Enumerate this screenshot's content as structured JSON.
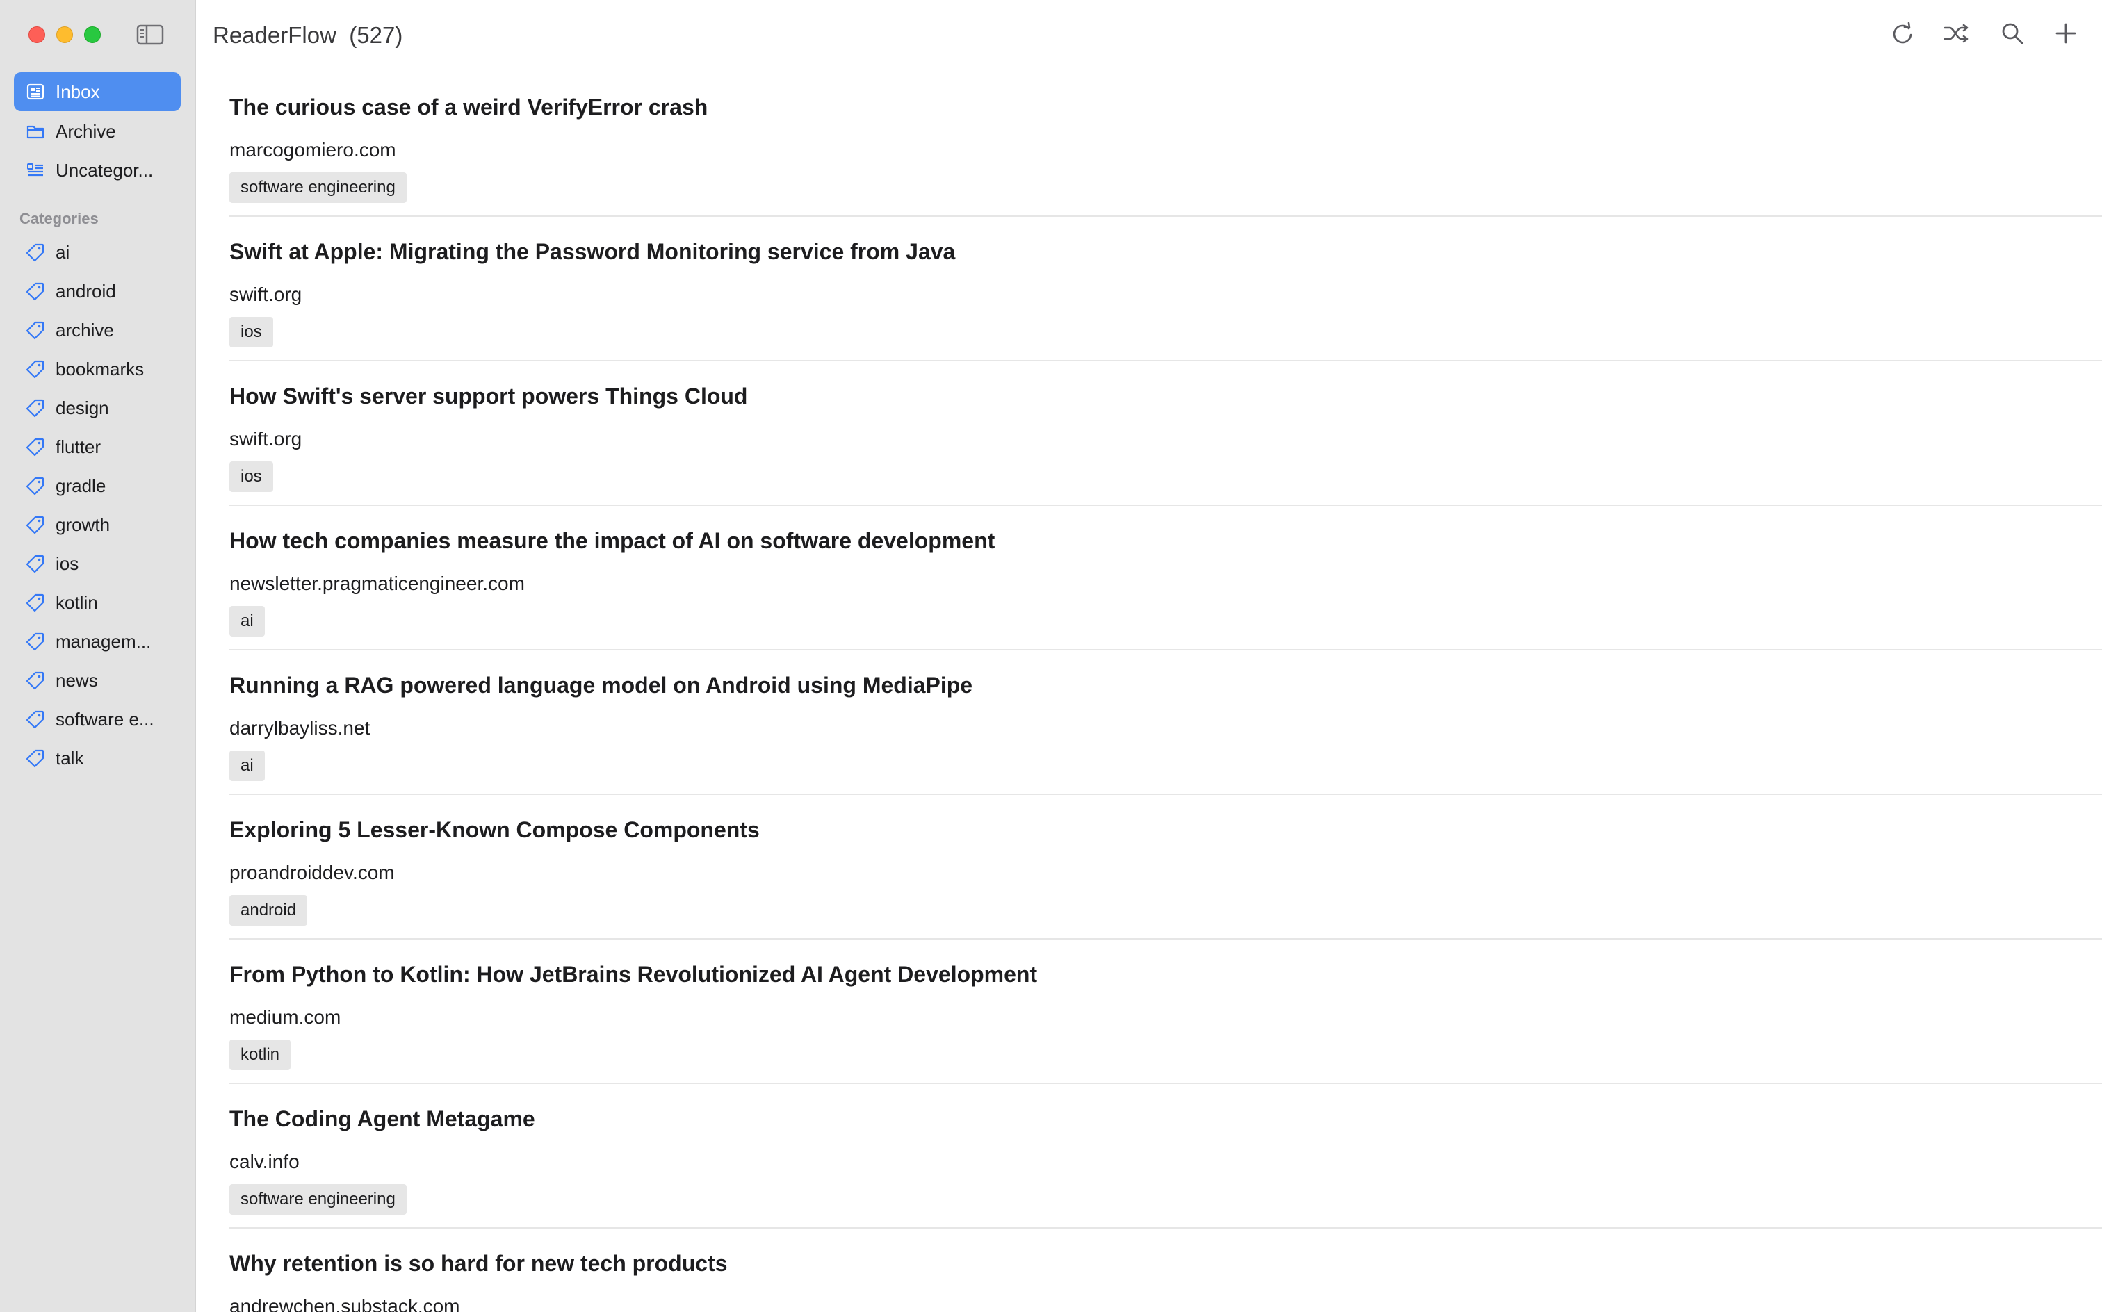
{
  "app": {
    "title": "ReaderFlow",
    "count": "(527)"
  },
  "sidebar": {
    "nav": [
      {
        "label": "Inbox",
        "icon": "inbox-icon",
        "active": true
      },
      {
        "label": "Archive",
        "icon": "folder-icon",
        "active": false
      },
      {
        "label": "Uncategor...",
        "icon": "list-icon",
        "active": false
      }
    ],
    "categories_heading": "Categories",
    "categories": [
      {
        "label": "ai"
      },
      {
        "label": "android"
      },
      {
        "label": "archive"
      },
      {
        "label": "bookmarks"
      },
      {
        "label": "design"
      },
      {
        "label": "flutter"
      },
      {
        "label": "gradle"
      },
      {
        "label": "growth"
      },
      {
        "label": "ios"
      },
      {
        "label": "kotlin"
      },
      {
        "label": "managem..."
      },
      {
        "label": "news"
      },
      {
        "label": "software e..."
      },
      {
        "label": "talk"
      }
    ]
  },
  "toolbar": {
    "icons": [
      "refresh-icon",
      "shuffle-icon",
      "search-icon",
      "plus-icon"
    ]
  },
  "articles": [
    {
      "title": "The curious case of a weird VerifyError crash",
      "site": "marcogomiero.com",
      "tag": "software engineering"
    },
    {
      "title": "Swift at Apple: Migrating the Password Monitoring service from Java",
      "site": "swift.org",
      "tag": "ios"
    },
    {
      "title": "How Swift's server support powers Things Cloud",
      "site": "swift.org",
      "tag": "ios"
    },
    {
      "title": "How tech companies measure the impact of AI on software development",
      "site": "newsletter.pragmaticengineer.com",
      "tag": "ai"
    },
    {
      "title": "Running a RAG powered language model on Android using MediaPipe",
      "site": "darrylbayliss.net",
      "tag": "ai"
    },
    {
      "title": "Exploring 5 Lesser-Known Compose Components",
      "site": "proandroiddev.com",
      "tag": "android"
    },
    {
      "title": "From Python to Kotlin: How JetBrains Revolutionized AI Agent Development",
      "site": "medium.com",
      "tag": "kotlin"
    },
    {
      "title": "The Coding Agent Metagame",
      "site": "calv.info",
      "tag": "software engineering"
    },
    {
      "title": "Why retention is so hard for new tech products",
      "site": "andrewchen.substack.com",
      "tag": ""
    }
  ],
  "colors": {
    "accent": "#4f8ef0",
    "icon_blue": "#3478f6",
    "sidebar_bg": "#e3e3e3"
  }
}
